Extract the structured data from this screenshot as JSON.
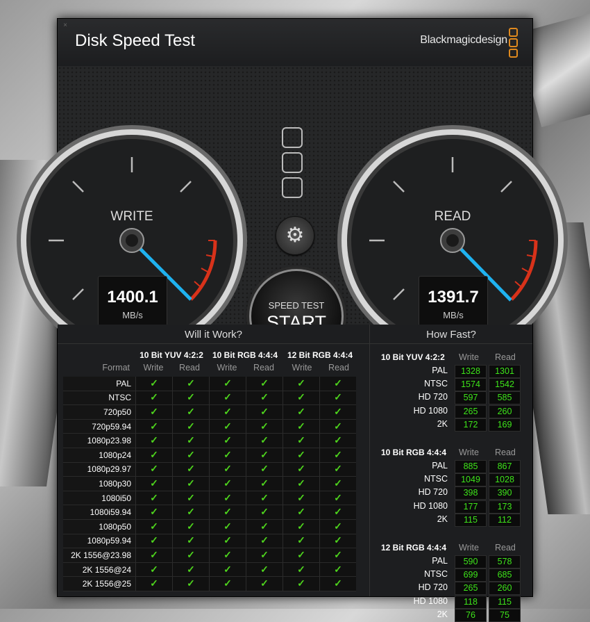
{
  "window": {
    "title": "Disk Speed Test",
    "brand": "Blackmagicdesign"
  },
  "icons": {
    "close": "×",
    "gear": "⚙",
    "check": "✓"
  },
  "colors": {
    "needle": "#1fb2f0",
    "redline": "#d8321a",
    "check": "#4ed51d",
    "value": "#3ee51a",
    "brand_logo": "#e08a1e"
  },
  "gauges": {
    "write": {
      "label": "WRITE",
      "value": "1400.1",
      "unit": "MB/s"
    },
    "read": {
      "label": "READ",
      "value": "1391.7",
      "unit": "MB/s"
    }
  },
  "start_button": {
    "sub": "SPEED TEST",
    "main": "START"
  },
  "will_it_work": {
    "title": "Will it Work?",
    "format_label": "Format",
    "groups": [
      {
        "name": "10 Bit YUV 4:2:2",
        "write": "Write",
        "read": "Read"
      },
      {
        "name": "10 Bit RGB 4:4:4",
        "write": "Write",
        "read": "Read"
      },
      {
        "name": "12 Bit RGB 4:4:4",
        "write": "Write",
        "read": "Read"
      }
    ],
    "formats": [
      "PAL",
      "NTSC",
      "720p50",
      "720p59.94",
      "1080p23.98",
      "1080p24",
      "1080p29.97",
      "1080p30",
      "1080i50",
      "1080i59.94",
      "1080p50",
      "1080p59.94",
      "2K 1556@23.98",
      "2K 1556@24",
      "2K 1556@25"
    ]
  },
  "how_fast": {
    "title": "How Fast?",
    "groups": [
      {
        "name": "10 Bit YUV 4:2:2",
        "write": "Write",
        "read": "Read",
        "rows": [
          {
            "name": "PAL",
            "write": "1328",
            "read": "1301"
          },
          {
            "name": "NTSC",
            "write": "1574",
            "read": "1542"
          },
          {
            "name": "HD 720",
            "write": "597",
            "read": "585"
          },
          {
            "name": "HD 1080",
            "write": "265",
            "read": "260"
          },
          {
            "name": "2K",
            "write": "172",
            "read": "169"
          }
        ]
      },
      {
        "name": "10 Bit RGB 4:4:4",
        "write": "Write",
        "read": "Read",
        "rows": [
          {
            "name": "PAL",
            "write": "885",
            "read": "867"
          },
          {
            "name": "NTSC",
            "write": "1049",
            "read": "1028"
          },
          {
            "name": "HD 720",
            "write": "398",
            "read": "390"
          },
          {
            "name": "HD 1080",
            "write": "177",
            "read": "173"
          },
          {
            "name": "2K",
            "write": "115",
            "read": "112"
          }
        ]
      },
      {
        "name": "12 Bit RGB 4:4:4",
        "write": "Write",
        "read": "Read",
        "rows": [
          {
            "name": "PAL",
            "write": "590",
            "read": "578"
          },
          {
            "name": "NTSC",
            "write": "699",
            "read": "685"
          },
          {
            "name": "HD 720",
            "write": "265",
            "read": "260"
          },
          {
            "name": "HD 1080",
            "write": "118",
            "read": "115"
          },
          {
            "name": "2K",
            "write": "76",
            "read": "75"
          }
        ]
      }
    ]
  }
}
